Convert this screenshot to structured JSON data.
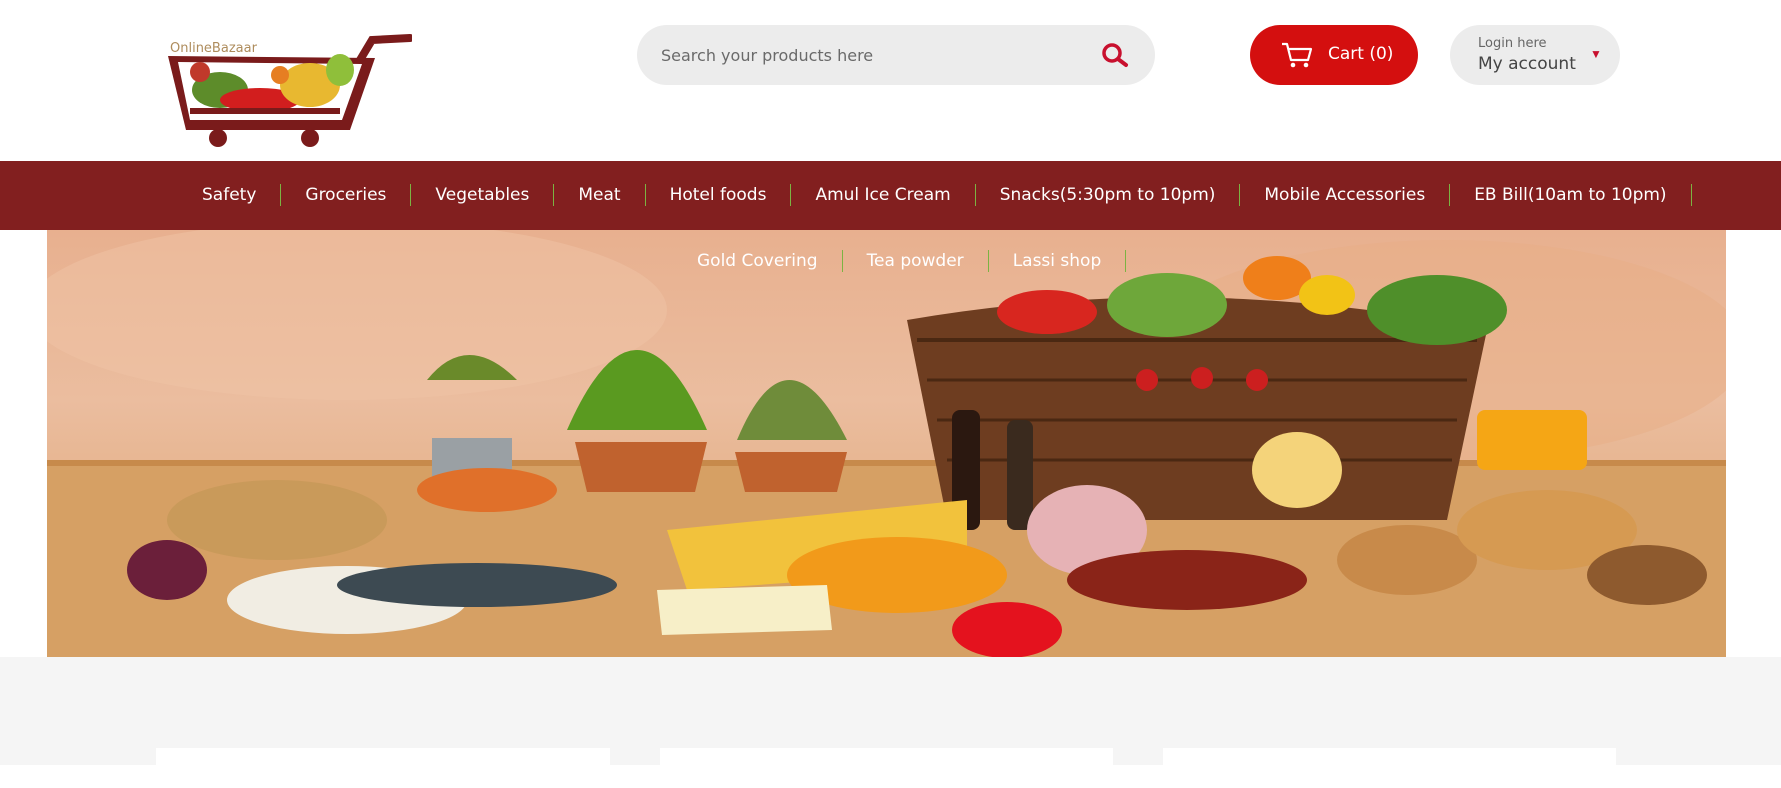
{
  "header": {
    "logo_text": "OnlineBazaar",
    "search": {
      "placeholder": "Search your products here",
      "icon": "search-icon"
    },
    "cart": {
      "label": "Cart (0)",
      "icon": "cart-icon"
    },
    "account": {
      "small_label": "Login here",
      "label": "My account",
      "caret": "▼"
    }
  },
  "nav": {
    "row1": [
      {
        "label": "Safety"
      },
      {
        "label": "Groceries"
      },
      {
        "label": "Vegetables"
      },
      {
        "label": "Meat"
      },
      {
        "label": "Hotel foods"
      },
      {
        "label": "Amul Ice Cream"
      },
      {
        "label": "Snacks(5:30pm to 10pm)"
      },
      {
        "label": "Mobile Accessories"
      },
      {
        "label": "EB Bill(10am to 10pm)"
      }
    ],
    "row2": [
      {
        "label": "Gold Covering"
      },
      {
        "label": "Tea powder"
      },
      {
        "label": "Lassi shop"
      }
    ]
  },
  "colors": {
    "brand_red": "#d40f0f",
    "nav_bg": "#821f1f",
    "separator": "#7cb342"
  }
}
